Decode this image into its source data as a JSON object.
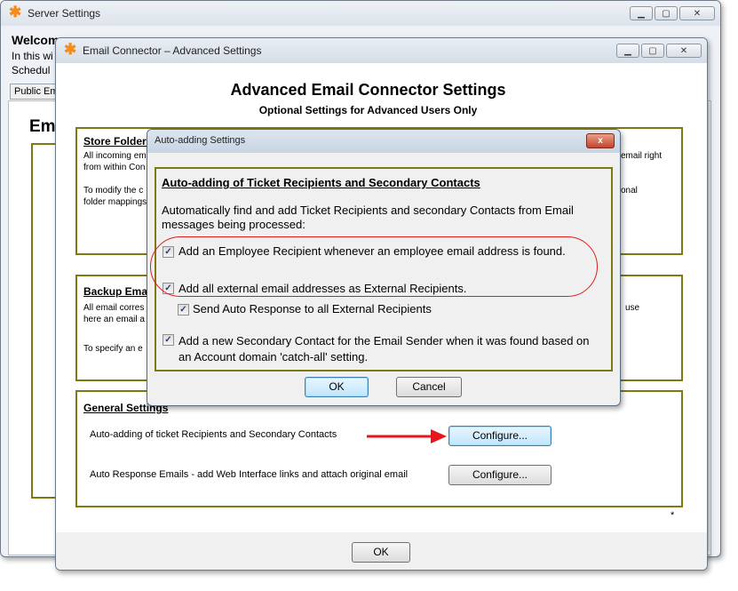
{
  "server_window": {
    "title": "Server Settings",
    "welcome": "Welcom",
    "intro_line1": "In this wi",
    "intro_line2": "Schedul",
    "tab_label": "Public Em",
    "heading": "Em"
  },
  "email_connector": {
    "title": "Email Connector – Advanced Settings",
    "heading": "Advanced Email Connector Settings",
    "subheading": "Optional Settings for Advanced Users Only",
    "store_folder": {
      "header": "Store Folder:",
      "line1": "All incoming em",
      "line1_right": "email right",
      "line2": "from within Con",
      "line3": "To modify the c",
      "line3_right": "onal",
      "line4": "folder mappings"
    },
    "backup": {
      "header": "Backup Ema",
      "line1": "All email corres",
      "line1_right": "use",
      "line2": "here an email a",
      "line3": "To specify an e"
    },
    "general": {
      "header": "General Settings",
      "row1_label": "Auto-adding of ticket Recipients and Secondary Contacts",
      "row1_button": "Configure...",
      "row2_label": "Auto Response Emails - add Web Interface links and attach original email",
      "row2_button": "Configure..."
    },
    "asterisk": "*",
    "ok_button": "OK"
  },
  "auto_adding_dialog": {
    "title": "Auto-adding Settings",
    "close_glyph": "x",
    "header": "Auto-adding of Ticket Recipients and Secondary Contacts",
    "description": "Automatically find and add Ticket Recipients and secondary Contacts from Email messages being processed:",
    "options": [
      {
        "label": "Add an Employee Recipient whenever an employee email address is found.",
        "checked": true
      },
      {
        "label": "Add all external email addresses as External Recipients.",
        "checked": true
      },
      {
        "label": "Send Auto Response to all External Recipients",
        "checked": true
      },
      {
        "label": "Add a new Secondary Contact for the Email Sender when it was found based on an Account domain 'catch-all' setting.",
        "checked": true
      }
    ],
    "ok_button": "OK",
    "cancel_button": "Cancel"
  },
  "colors": {
    "panel_border": "#7d7a12",
    "highlight_red": "#e01b1b",
    "arrow_red": "#e8161b",
    "app_icon": "#f28c1c"
  },
  "icons": [
    "app-asterisk-icon",
    "minimize-icon",
    "maximize-icon",
    "close-icon",
    "check-icon",
    "arrow-right-icon"
  ]
}
